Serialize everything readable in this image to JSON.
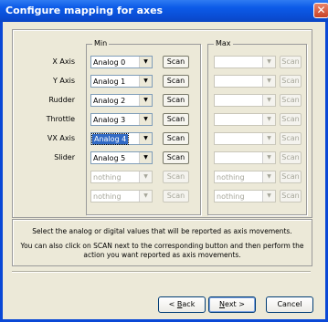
{
  "window": {
    "title": "Configure mapping for axes",
    "close_glyph": "✕"
  },
  "groups": {
    "min_label": "Min",
    "max_label": "Max"
  },
  "rows": [
    {
      "label": "X Axis",
      "min_value": "Analog 0",
      "max_value": "",
      "min_enabled": true
    },
    {
      "label": "Y Axis",
      "min_value": "Analog 1",
      "max_value": "",
      "min_enabled": true
    },
    {
      "label": "Rudder",
      "min_value": "Analog 2",
      "max_value": "",
      "min_enabled": true
    },
    {
      "label": "Throttle",
      "min_value": "Analog 3",
      "max_value": "",
      "min_enabled": true
    },
    {
      "label": "VX Axis",
      "min_value": "Analog 4",
      "max_value": "",
      "min_enabled": true,
      "focused": true
    },
    {
      "label": "Slider",
      "min_value": "Analog 5",
      "max_value": "",
      "min_enabled": true
    },
    {
      "label": "",
      "min_value": "nothing",
      "max_value": "nothing",
      "min_enabled": false
    },
    {
      "label": "",
      "min_value": "nothing",
      "max_value": "nothing",
      "min_enabled": false
    }
  ],
  "scan_label": "Scan",
  "arrow_glyph": "▼",
  "info": {
    "line1": "Select the analog or digital values that will be reported as axis movements.",
    "line2": "You can also click on SCAN next to the corresponding button and then perform the",
    "line3": "action you want reported as axis movements."
  },
  "buttons": {
    "back_prefix": "< ",
    "back_key": "B",
    "back_rest": "ack",
    "next_key": "N",
    "next_rest": "ext >",
    "cancel": "Cancel"
  }
}
